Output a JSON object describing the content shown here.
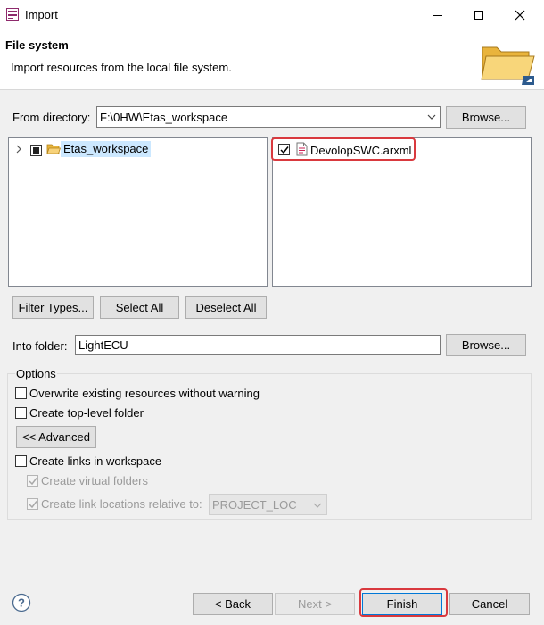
{
  "window": {
    "title": "Import",
    "minimize_icon": "minimize-icon",
    "maximize_icon": "maximize-icon",
    "close_icon": "close-icon"
  },
  "header": {
    "title": "File system",
    "description": "Import resources from the local file system.",
    "image_icon": "folder-icon"
  },
  "from_directory": {
    "label": "From directory:",
    "value": "F:\\0HW\\Etas_workspace",
    "browse_label": "Browse..."
  },
  "left_tree": {
    "items": [
      {
        "label": "Etas_workspace",
        "icon": "folder-icon",
        "checked": "partial",
        "selected": true
      }
    ]
  },
  "right_list": {
    "items": [
      {
        "label": "DevolopSWC.arxml",
        "icon": "file-icon",
        "checked": true
      }
    ]
  },
  "selection_buttons": {
    "filter_types": "Filter Types...",
    "select_all": "Select All",
    "deselect_all": "Deselect All"
  },
  "into_folder": {
    "label": "Into folder:",
    "value": "LightECU",
    "browse_label": "Browse..."
  },
  "options": {
    "group_label": "Options",
    "overwrite": {
      "label": "Overwrite existing resources without warning",
      "checked": false
    },
    "create_top_level": {
      "label": "Create top-level folder",
      "checked": false
    },
    "advanced_label": "<< Advanced",
    "create_links": {
      "label": "Create links in workspace",
      "checked": false
    },
    "create_virtual_folders": {
      "label": "Create virtual folders",
      "checked": true,
      "enabled": false
    },
    "create_link_locations": {
      "label": "Create link locations relative to:",
      "checked": true,
      "enabled": false
    },
    "link_location_value": "PROJECT_LOC"
  },
  "footer": {
    "help_icon": "help-icon",
    "back_label": "< Back",
    "next_label": "Next >",
    "finish_label": "Finish",
    "cancel_label": "Cancel"
  },
  "colors": {
    "highlight": "#d9393e",
    "selection": "#cce8ff",
    "folder": "#f6c443"
  }
}
